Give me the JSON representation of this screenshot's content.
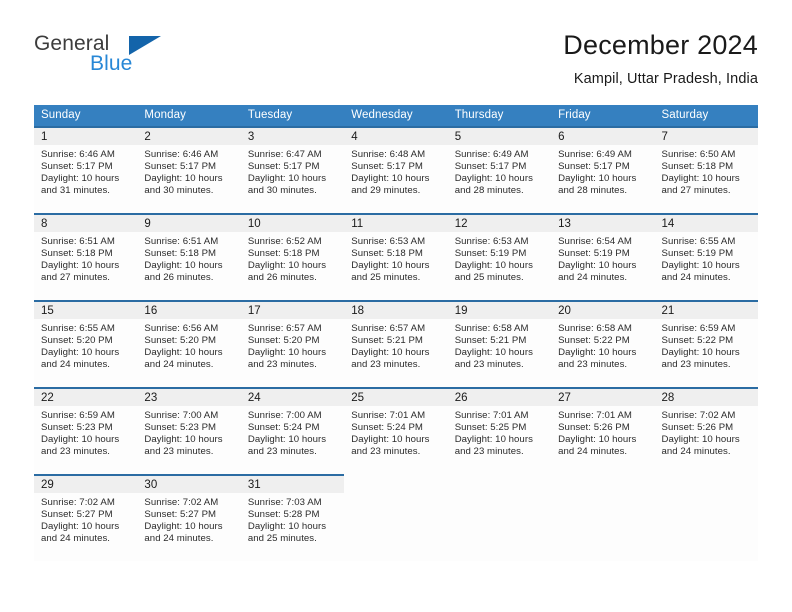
{
  "brand": {
    "name_part1": "General",
    "name_part2": "Blue",
    "triangle_icon": "triangle-icon",
    "accent_color": "#2787d6",
    "dark_color": "#1364aa"
  },
  "header": {
    "title": "December 2024",
    "subtitle": "Kampil, Uttar Pradesh, India"
  },
  "calendar": {
    "header_bg": "#3580c0",
    "row_border_color": "#2b6ca3",
    "daynum_bg": "#efefef",
    "weekday_headers": [
      "Sunday",
      "Monday",
      "Tuesday",
      "Wednesday",
      "Thursday",
      "Friday",
      "Saturday"
    ],
    "weeks": [
      [
        {
          "day": "1",
          "sunrise": "Sunrise: 6:46 AM",
          "sunset": "Sunset: 5:17 PM",
          "daylight_line1": "Daylight: 10 hours",
          "daylight_line2": "and 31 minutes."
        },
        {
          "day": "2",
          "sunrise": "Sunrise: 6:46 AM",
          "sunset": "Sunset: 5:17 PM",
          "daylight_line1": "Daylight: 10 hours",
          "daylight_line2": "and 30 minutes."
        },
        {
          "day": "3",
          "sunrise": "Sunrise: 6:47 AM",
          "sunset": "Sunset: 5:17 PM",
          "daylight_line1": "Daylight: 10 hours",
          "daylight_line2": "and 30 minutes."
        },
        {
          "day": "4",
          "sunrise": "Sunrise: 6:48 AM",
          "sunset": "Sunset: 5:17 PM",
          "daylight_line1": "Daylight: 10 hours",
          "daylight_line2": "and 29 minutes."
        },
        {
          "day": "5",
          "sunrise": "Sunrise: 6:49 AM",
          "sunset": "Sunset: 5:17 PM",
          "daylight_line1": "Daylight: 10 hours",
          "daylight_line2": "and 28 minutes."
        },
        {
          "day": "6",
          "sunrise": "Sunrise: 6:49 AM",
          "sunset": "Sunset: 5:17 PM",
          "daylight_line1": "Daylight: 10 hours",
          "daylight_line2": "and 28 minutes."
        },
        {
          "day": "7",
          "sunrise": "Sunrise: 6:50 AM",
          "sunset": "Sunset: 5:18 PM",
          "daylight_line1": "Daylight: 10 hours",
          "daylight_line2": "and 27 minutes."
        }
      ],
      [
        {
          "day": "8",
          "sunrise": "Sunrise: 6:51 AM",
          "sunset": "Sunset: 5:18 PM",
          "daylight_line1": "Daylight: 10 hours",
          "daylight_line2": "and 27 minutes."
        },
        {
          "day": "9",
          "sunrise": "Sunrise: 6:51 AM",
          "sunset": "Sunset: 5:18 PM",
          "daylight_line1": "Daylight: 10 hours",
          "daylight_line2": "and 26 minutes."
        },
        {
          "day": "10",
          "sunrise": "Sunrise: 6:52 AM",
          "sunset": "Sunset: 5:18 PM",
          "daylight_line1": "Daylight: 10 hours",
          "daylight_line2": "and 26 minutes."
        },
        {
          "day": "11",
          "sunrise": "Sunrise: 6:53 AM",
          "sunset": "Sunset: 5:18 PM",
          "daylight_line1": "Daylight: 10 hours",
          "daylight_line2": "and 25 minutes."
        },
        {
          "day": "12",
          "sunrise": "Sunrise: 6:53 AM",
          "sunset": "Sunset: 5:19 PM",
          "daylight_line1": "Daylight: 10 hours",
          "daylight_line2": "and 25 minutes."
        },
        {
          "day": "13",
          "sunrise": "Sunrise: 6:54 AM",
          "sunset": "Sunset: 5:19 PM",
          "daylight_line1": "Daylight: 10 hours",
          "daylight_line2": "and 24 minutes."
        },
        {
          "day": "14",
          "sunrise": "Sunrise: 6:55 AM",
          "sunset": "Sunset: 5:19 PM",
          "daylight_line1": "Daylight: 10 hours",
          "daylight_line2": "and 24 minutes."
        }
      ],
      [
        {
          "day": "15",
          "sunrise": "Sunrise: 6:55 AM",
          "sunset": "Sunset: 5:20 PM",
          "daylight_line1": "Daylight: 10 hours",
          "daylight_line2": "and 24 minutes."
        },
        {
          "day": "16",
          "sunrise": "Sunrise: 6:56 AM",
          "sunset": "Sunset: 5:20 PM",
          "daylight_line1": "Daylight: 10 hours",
          "daylight_line2": "and 24 minutes."
        },
        {
          "day": "17",
          "sunrise": "Sunrise: 6:57 AM",
          "sunset": "Sunset: 5:20 PM",
          "daylight_line1": "Daylight: 10 hours",
          "daylight_line2": "and 23 minutes."
        },
        {
          "day": "18",
          "sunrise": "Sunrise: 6:57 AM",
          "sunset": "Sunset: 5:21 PM",
          "daylight_line1": "Daylight: 10 hours",
          "daylight_line2": "and 23 minutes."
        },
        {
          "day": "19",
          "sunrise": "Sunrise: 6:58 AM",
          "sunset": "Sunset: 5:21 PM",
          "daylight_line1": "Daylight: 10 hours",
          "daylight_line2": "and 23 minutes."
        },
        {
          "day": "20",
          "sunrise": "Sunrise: 6:58 AM",
          "sunset": "Sunset: 5:22 PM",
          "daylight_line1": "Daylight: 10 hours",
          "daylight_line2": "and 23 minutes."
        },
        {
          "day": "21",
          "sunrise": "Sunrise: 6:59 AM",
          "sunset": "Sunset: 5:22 PM",
          "daylight_line1": "Daylight: 10 hours",
          "daylight_line2": "and 23 minutes."
        }
      ],
      [
        {
          "day": "22",
          "sunrise": "Sunrise: 6:59 AM",
          "sunset": "Sunset: 5:23 PM",
          "daylight_line1": "Daylight: 10 hours",
          "daylight_line2": "and 23 minutes."
        },
        {
          "day": "23",
          "sunrise": "Sunrise: 7:00 AM",
          "sunset": "Sunset: 5:23 PM",
          "daylight_line1": "Daylight: 10 hours",
          "daylight_line2": "and 23 minutes."
        },
        {
          "day": "24",
          "sunrise": "Sunrise: 7:00 AM",
          "sunset": "Sunset: 5:24 PM",
          "daylight_line1": "Daylight: 10 hours",
          "daylight_line2": "and 23 minutes."
        },
        {
          "day": "25",
          "sunrise": "Sunrise: 7:01 AM",
          "sunset": "Sunset: 5:24 PM",
          "daylight_line1": "Daylight: 10 hours",
          "daylight_line2": "and 23 minutes."
        },
        {
          "day": "26",
          "sunrise": "Sunrise: 7:01 AM",
          "sunset": "Sunset: 5:25 PM",
          "daylight_line1": "Daylight: 10 hours",
          "daylight_line2": "and 23 minutes."
        },
        {
          "day": "27",
          "sunrise": "Sunrise: 7:01 AM",
          "sunset": "Sunset: 5:26 PM",
          "daylight_line1": "Daylight: 10 hours",
          "daylight_line2": "and 24 minutes."
        },
        {
          "day": "28",
          "sunrise": "Sunrise: 7:02 AM",
          "sunset": "Sunset: 5:26 PM",
          "daylight_line1": "Daylight: 10 hours",
          "daylight_line2": "and 24 minutes."
        }
      ],
      [
        {
          "day": "29",
          "sunrise": "Sunrise: 7:02 AM",
          "sunset": "Sunset: 5:27 PM",
          "daylight_line1": "Daylight: 10 hours",
          "daylight_line2": "and 24 minutes."
        },
        {
          "day": "30",
          "sunrise": "Sunrise: 7:02 AM",
          "sunset": "Sunset: 5:27 PM",
          "daylight_line1": "Daylight: 10 hours",
          "daylight_line2": "and 24 minutes."
        },
        {
          "day": "31",
          "sunrise": "Sunrise: 7:03 AM",
          "sunset": "Sunset: 5:28 PM",
          "daylight_line1": "Daylight: 10 hours",
          "daylight_line2": "and 25 minutes."
        },
        {
          "day": "",
          "sunrise": "",
          "sunset": "",
          "daylight_line1": "",
          "daylight_line2": ""
        },
        {
          "day": "",
          "sunrise": "",
          "sunset": "",
          "daylight_line1": "",
          "daylight_line2": ""
        },
        {
          "day": "",
          "sunrise": "",
          "sunset": "",
          "daylight_line1": "",
          "daylight_line2": ""
        },
        {
          "day": "",
          "sunrise": "",
          "sunset": "",
          "daylight_line1": "",
          "daylight_line2": ""
        }
      ]
    ]
  }
}
